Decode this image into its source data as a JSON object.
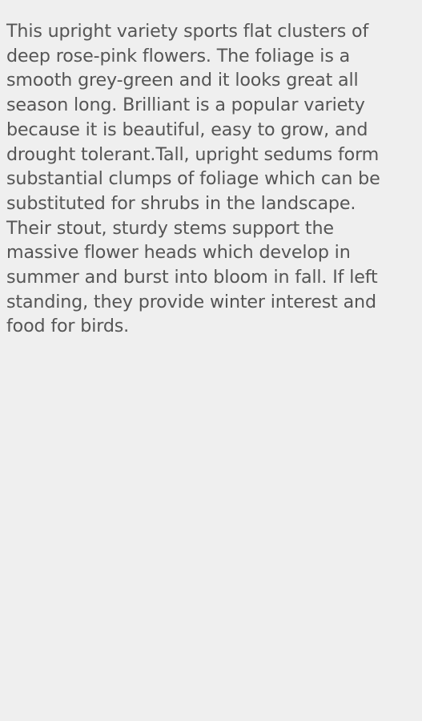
{
  "plant_description": {
    "lines": [
      "This upright variety sports flat clusters of",
      "deep rose-pink flowers. The foliage is a",
      "smooth grey-green and it looks great all",
      "season long. Brilliant is a popular variety",
      "because it is beautiful, easy to grow, and",
      "drought tolerant.Tall, upright sedums form",
      "substantial clumps of foliage which can be",
      "substituted for shrubs in the landscape.",
      "Their stout, sturdy stems support the",
      "massive flower heads which develop in",
      "summer and burst into bloom in fall. If left",
      "standing, they provide winter interest and",
      "food for birds."
    ]
  },
  "colors": {
    "background": "#efefef",
    "text": "#555555"
  }
}
